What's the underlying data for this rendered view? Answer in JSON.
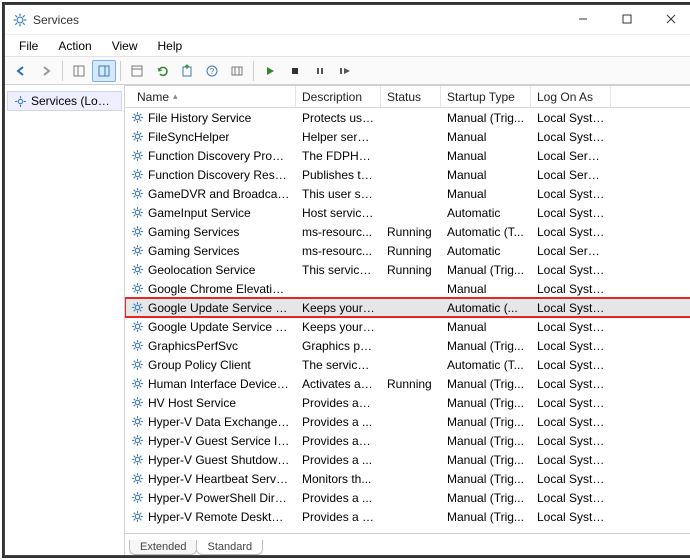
{
  "window": {
    "title": "Services"
  },
  "menu": {
    "file": "File",
    "action": "Action",
    "view": "View",
    "help": "Help"
  },
  "nav": {
    "root_label": "Services (Local)"
  },
  "toolbar_icons": [
    "back",
    "forward",
    "up-level",
    "show-hide-tree",
    "properties",
    "refresh",
    "export",
    "help",
    "show-hide-action",
    "play",
    "stop",
    "pause",
    "restart"
  ],
  "columns": {
    "name": "Name",
    "description": "Description",
    "status": "Status",
    "startup": "Startup Type",
    "logon": "Log On As"
  },
  "tabs": {
    "extended": "Extended",
    "standard": "Standard"
  },
  "highlight_index": 10,
  "services": [
    {
      "name": "File History Service",
      "description": "Protects use...",
      "status": "",
      "startup": "Manual (Trig...",
      "logon": "Local Syste..."
    },
    {
      "name": "FileSyncHelper",
      "description": "Helper servi...",
      "status": "",
      "startup": "Manual",
      "logon": "Local Syste..."
    },
    {
      "name": "Function Discovery Provide...",
      "description": "The FDPHO...",
      "status": "",
      "startup": "Manual",
      "logon": "Local Service"
    },
    {
      "name": "Function Discovery Resourc...",
      "description": "Publishes th...",
      "status": "",
      "startup": "Manual",
      "logon": "Local Service"
    },
    {
      "name": "GameDVR and Broadcast Us...",
      "description": "This user ser...",
      "status": "",
      "startup": "Manual",
      "logon": "Local Syste..."
    },
    {
      "name": "GameInput Service",
      "description": "Host service...",
      "status": "",
      "startup": "Automatic",
      "logon": "Local Syste..."
    },
    {
      "name": "Gaming Services",
      "description": "ms-resourc...",
      "status": "Running",
      "startup": "Automatic (T...",
      "logon": "Local Syste..."
    },
    {
      "name": "Gaming Services",
      "description": "ms-resourc...",
      "status": "Running",
      "startup": "Automatic",
      "logon": "Local Service"
    },
    {
      "name": "Geolocation Service",
      "description": "This service ...",
      "status": "Running",
      "startup": "Manual (Trig...",
      "logon": "Local Syste..."
    },
    {
      "name": "Google Chrome Elevation S...",
      "description": "",
      "status": "",
      "startup": "Manual",
      "logon": "Local Syste..."
    },
    {
      "name": "Google Update Service (gup...",
      "description": "Keeps your ...",
      "status": "",
      "startup": "Automatic (...",
      "logon": "Local Syste..."
    },
    {
      "name": "Google Update Service (gup...",
      "description": "Keeps your ...",
      "status": "",
      "startup": "Manual",
      "logon": "Local Syste..."
    },
    {
      "name": "GraphicsPerfSvc",
      "description": "Graphics pe...",
      "status": "",
      "startup": "Manual (Trig...",
      "logon": "Local Syste..."
    },
    {
      "name": "Group Policy Client",
      "description": "The service i...",
      "status": "",
      "startup": "Automatic (T...",
      "logon": "Local Syste..."
    },
    {
      "name": "Human Interface Device Ser...",
      "description": "Activates an...",
      "status": "Running",
      "startup": "Manual (Trig...",
      "logon": "Local Syste..."
    },
    {
      "name": "HV Host Service",
      "description": "Provides an ...",
      "status": "",
      "startup": "Manual (Trig...",
      "logon": "Local Syste..."
    },
    {
      "name": "Hyper-V Data Exchange Ser...",
      "description": "Provides a ...",
      "status": "",
      "startup": "Manual (Trig...",
      "logon": "Local Syste..."
    },
    {
      "name": "Hyper-V Guest Service Inter...",
      "description": "Provides an ...",
      "status": "",
      "startup": "Manual (Trig...",
      "logon": "Local Syste..."
    },
    {
      "name": "Hyper-V Guest Shutdown S...",
      "description": "Provides a ...",
      "status": "",
      "startup": "Manual (Trig...",
      "logon": "Local Syste..."
    },
    {
      "name": "Hyper-V Heartbeat Service",
      "description": "Monitors th...",
      "status": "",
      "startup": "Manual (Trig...",
      "logon": "Local Syste..."
    },
    {
      "name": "Hyper-V PowerShell Direct ...",
      "description": "Provides a ...",
      "status": "",
      "startup": "Manual (Trig...",
      "logon": "Local Syste..."
    },
    {
      "name": "Hyper-V Remote Desktop Vi...",
      "description": "Provides a p...",
      "status": "",
      "startup": "Manual (Trig...",
      "logon": "Local Syste..."
    }
  ]
}
